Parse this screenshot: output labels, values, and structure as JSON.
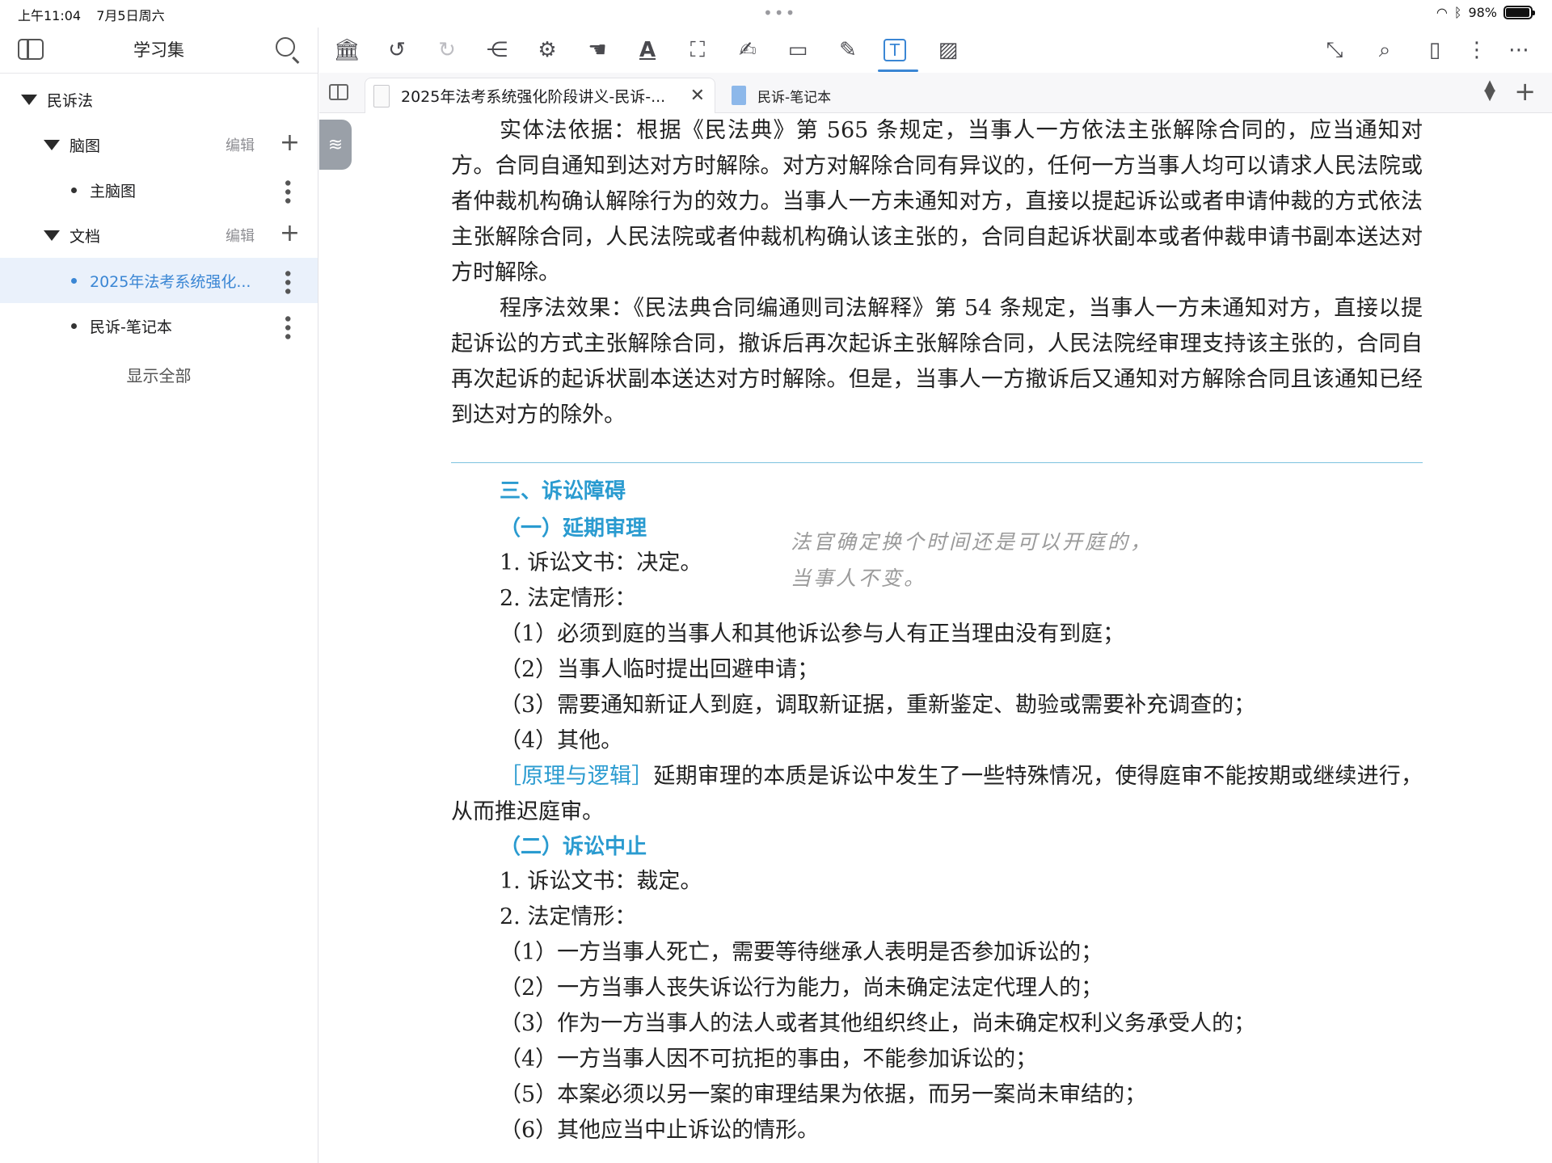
{
  "status_bar": {
    "time": "上午11:04",
    "date": "7月5日周六",
    "battery": "98%"
  },
  "sidebar": {
    "title": "学习集",
    "root": "民诉法",
    "groups": [
      {
        "label": "脑图",
        "edit": "编辑",
        "items": [
          {
            "label": "主脑图"
          }
        ]
      },
      {
        "label": "文档",
        "edit": "编辑",
        "items": [
          {
            "label": "2025年法考系统强化..."
          },
          {
            "label": "民诉-笔记本"
          }
        ]
      }
    ],
    "show_all": "显示全部"
  },
  "toolbar": {
    "icons": [
      "library-icon",
      "undo-icon",
      "redo-icon",
      "share-icon",
      "settings-icon",
      "hand-icon",
      "text-color-icon",
      "crop-icon",
      "signature-icon",
      "rectangle-icon",
      "pen-icon",
      "textbox-icon",
      "image-icon",
      "collapse-icon",
      "search-doc-icon",
      "bookmark-icon",
      "more-vertical-icon",
      "more-horizontal-icon"
    ],
    "accent": "#3a86d4"
  },
  "tabs": [
    {
      "label": "2025年法考系统强化阶段讲义-民诉-...",
      "close": "✕"
    },
    {
      "label": "民诉-笔记本"
    }
  ],
  "document": {
    "para1": "实体法依据：根据《民法典》第 565 条规定，当事人一方依法主张解除合同的，应当通知对方。合同自通知到达对方时解除。对方对解除合同有异议的，任何一方当事人均可以请求人民法院或者仲裁机构确认解除行为的效力。当事人一方未通知对方，直接以提起诉讼或者申请仲裁的方式依法主张解除合同，人民法院或者仲裁机构确认该主张的，合同自起诉状副本或者仲裁申请书副本送达对方时解除。",
    "para2": "程序法效果：《民法典合同编通则司法解释》第 54 条规定，当事人一方未通知对方，直接以提起诉讼的方式主张解除合同，撤诉后再次起诉主张解除合同，人民法院经审理支持该主张的，合同自再次起诉的起诉状副本送达对方时解除。但是，当事人一方撤诉后又通知对方解除合同且该通知已经到达对方的除外。",
    "section3": "三、诉讼障碍",
    "sub1": "（一）延期审理",
    "sub1_lines": [
      "1. 诉讼文书：决定。",
      "2. 法定情形：",
      "（1）必须到庭的当事人和其他诉讼参与人有正当理由没有到庭；",
      "（2）当事人临时提出回避申请；",
      "（3）需要通知新证人到庭，调取新证据，重新鉴定、勘验或需要补充调查的；",
      "（4）其他。"
    ],
    "note_tag": "［原理与逻辑］",
    "note_text": "延期审理的本质是诉讼中发生了一些特殊情况，使得庭审不能按期或继续进行，从而推迟庭审。",
    "sub2": "（二）诉讼中止",
    "sub2_lines": [
      "1. 诉讼文书：裁定。",
      "2. 法定情形：",
      "（1）一方当事人死亡，需要等待继承人表明是否参加诉讼的；",
      "（2）一方当事人丧失诉讼行为能力，尚未确定法定代理人的；",
      "（3）作为一方当事人的法人或者其他组织终止，尚未确定权利义务承受人的；",
      "（4）一方当事人因不可抗拒的事由，不能参加诉讼的；",
      "（5）本案必须以另一案的审理结果为依据，而另一案尚未审结的；",
      "（6）其他应当中止诉讼的情形。"
    ],
    "handwritten": [
      "法官确定换个时间还是可以开庭的，",
      "当事人不变。"
    ]
  }
}
